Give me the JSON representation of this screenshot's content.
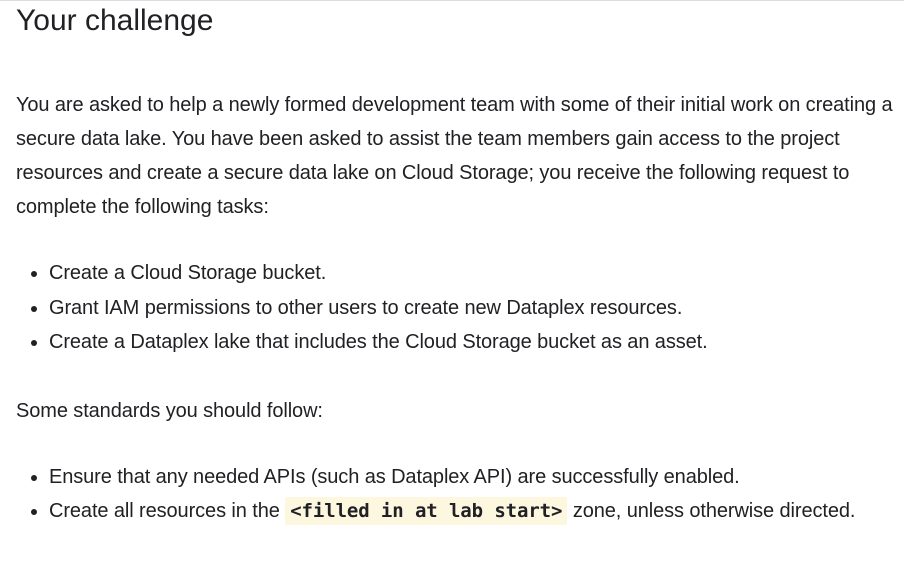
{
  "title": "Your challenge",
  "intro": "You are asked to help a newly formed development team with some of their initial work on creating a secure data lake. You have been asked to assist the team members gain access to the project resources and create a secure data lake on Cloud Storage; you receive the following request to complete the following tasks:",
  "tasks": [
    "Create a Cloud Storage bucket.",
    "Grant IAM permissions to other users to create new Dataplex resources.",
    "Create a Dataplex lake that includes the Cloud Storage bucket as an asset."
  ],
  "standards_lead": "Some standards you should follow:",
  "standards": {
    "item1": "Ensure that any needed APIs (such as Dataplex API) are successfully enabled.",
    "item2_before": "Create all resources in the ",
    "item2_code": "<filled in at lab start>",
    "item2_after": " zone, unless otherwise directed."
  },
  "colors": {
    "text": "#202124",
    "code_background": "#fef7e0"
  }
}
